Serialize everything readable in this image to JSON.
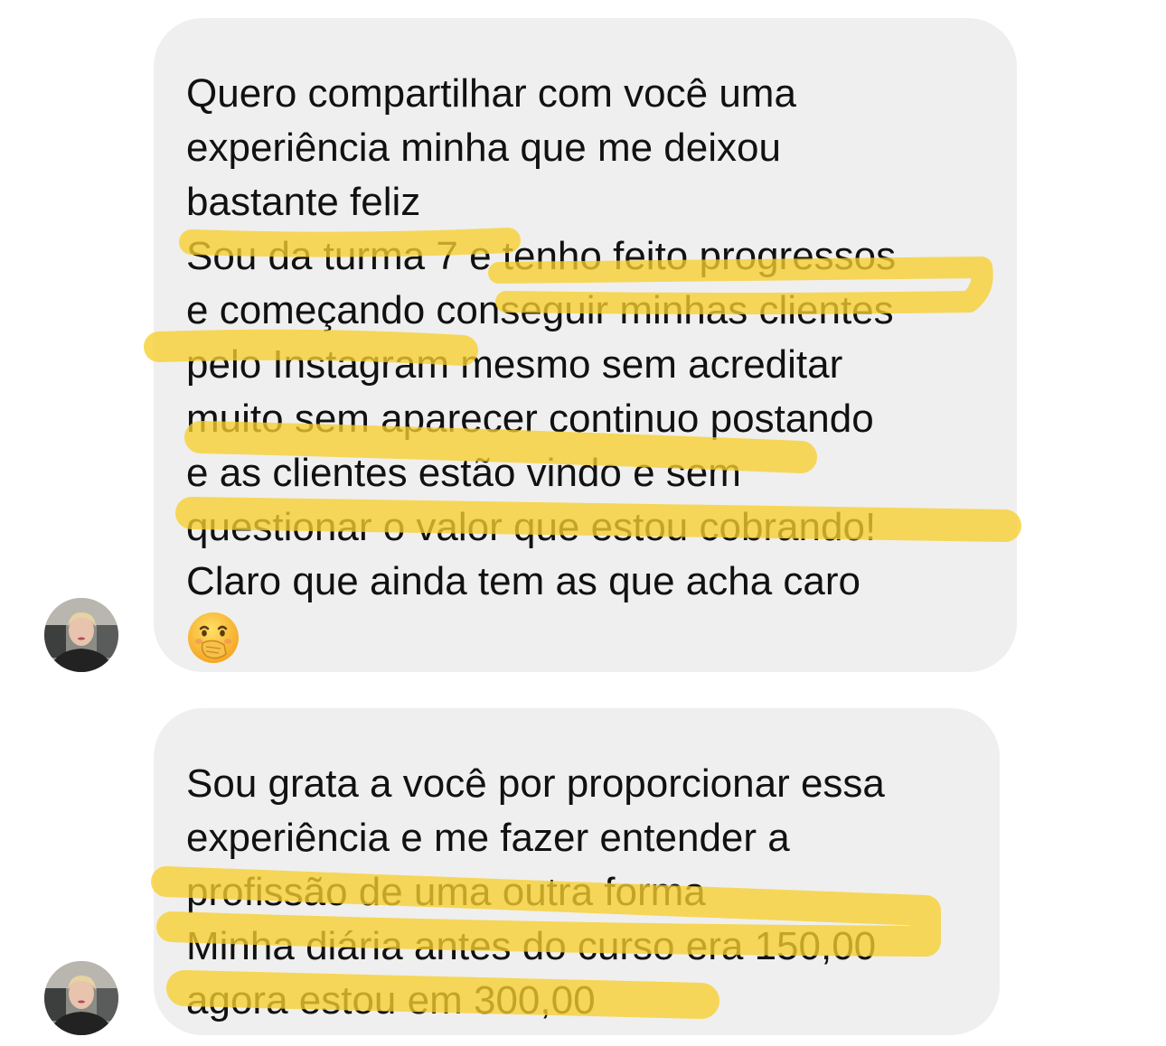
{
  "conversation": {
    "messages": [
      {
        "lines": [
          "Quero compartilhar com você uma",
          "experiência minha que me deixou",
          "bastante feliz",
          "Sou da turma 7 e tenho feito progressos",
          "e começando conseguir minhas clientes",
          "pelo Instagram mesmo sem acreditar",
          "muito sem aparecer continuo postando",
          "e as clientes estão vindo e sem",
          "questionar o valor que estou cobrando!",
          "Claro que ainda tem as que acha caro"
        ],
        "emoji": "face-with-hand-over-mouth",
        "avatar": "sender-avatar"
      },
      {
        "lines": [
          "Sou grata a você por proporcionar essa",
          "experiência e me fazer entender a",
          "profissão de uma outra forma",
          "Minha diária antes do curso era 150,00",
          "agora estou em 300,00"
        ],
        "avatar": "sender-avatar"
      }
    ]
  },
  "colors": {
    "bubble_bg": "#efefef",
    "text": "#111111",
    "highlight": "#f7cf2c"
  }
}
